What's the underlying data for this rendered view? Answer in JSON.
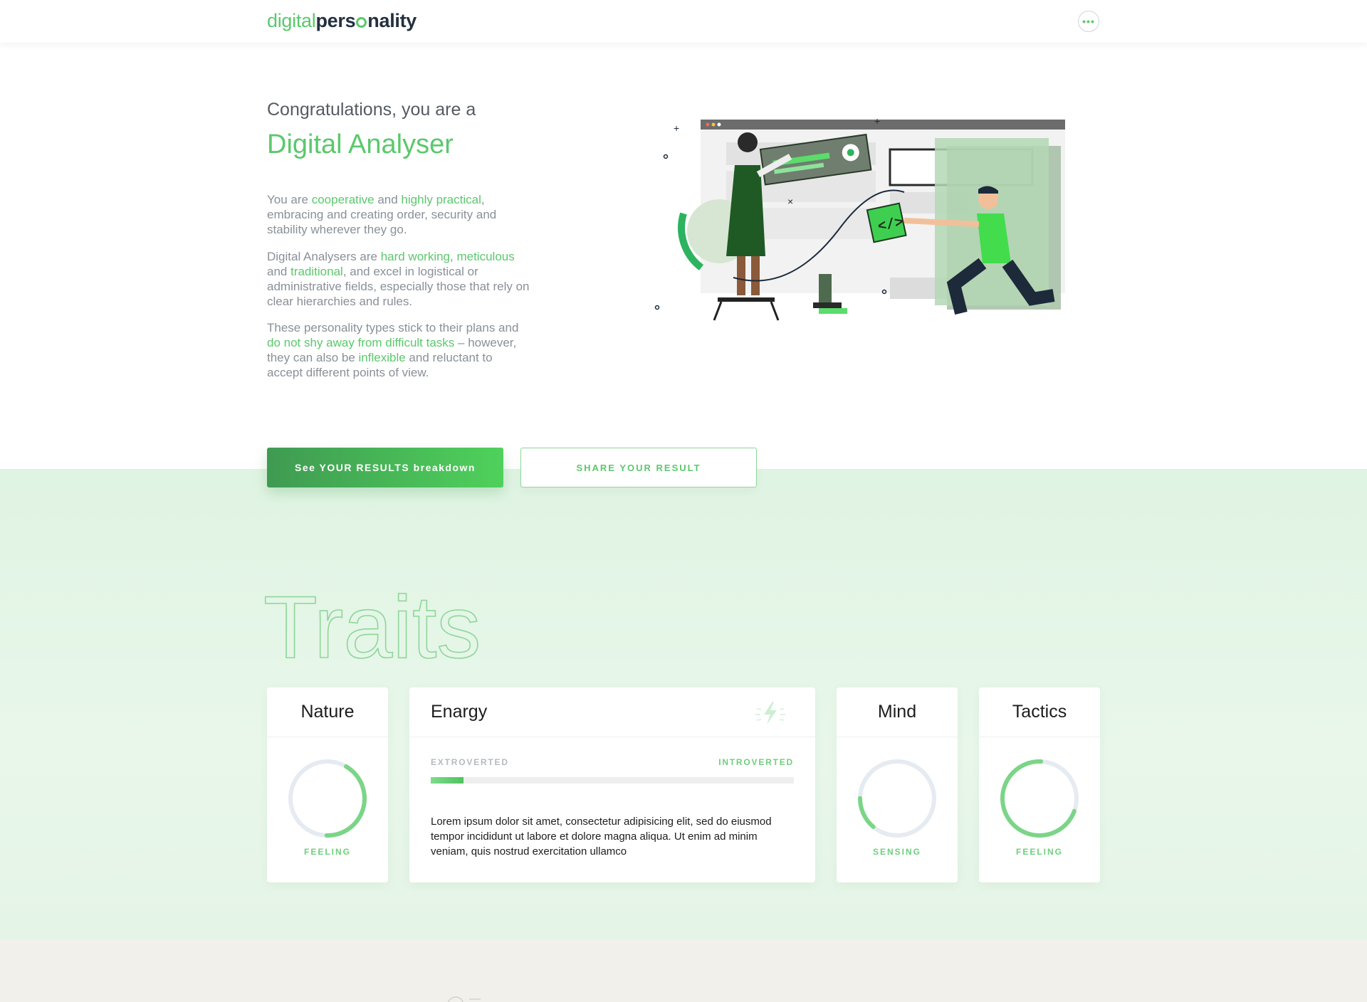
{
  "header": {
    "logo": {
      "part1": "digital",
      "part2": "pers",
      "part3": "nality"
    },
    "menu_icon": "more-dots-icon"
  },
  "hero": {
    "intro": "Congratulations, you are a",
    "title": "Digital Analyser",
    "p1": {
      "t1": "You are ",
      "h1": "cooperative",
      "t2": " and ",
      "h2": "highly practical",
      "t3": ", embracing and creating order, security and stability wherever they go."
    },
    "p2": {
      "t1": "Digital Analysers are ",
      "h1": "hard working",
      "t2": ", ",
      "h2": "meticulous",
      "t3": " and ",
      "h3": "traditional",
      "t4": ", and excel in logistical or administrative fields, especially those that rely on clear hierarchies and rules."
    },
    "p3": {
      "t1": "These personality types stick to their plans and ",
      "h1": "do not shy away from difficult tasks",
      "t2": " – however, they can also be ",
      "h2": "inflexible",
      "t3": " and reluctant to accept different points of view."
    }
  },
  "actions": {
    "primary": "See YOUR RESULTS breakdown",
    "secondary": "SHARE YOUR RESULT"
  },
  "traits": {
    "title": "Traits",
    "nature": {
      "title": "Nature",
      "label": "FEELING",
      "progress": 0.42
    },
    "energy": {
      "title": "Enargy",
      "icon": "lightning-icon",
      "left_label": "EXTROVERTED",
      "right_label": "INTROVERTED",
      "progress": 0.09,
      "text": "Lorem ipsum dolor sit amet, consectetur adipisicing elit, sed do eiusmod tempor incididunt ut labore et dolore magna aliqua. Ut enim ad minim veniam, quis nostrud exercitation ullamco"
    },
    "mind": {
      "title": "Mind",
      "label": "SENSING",
      "progress": 0.14
    },
    "tactics": {
      "title": "Tactics",
      "label": "FEELING",
      "progress": 0.7
    }
  },
  "colors": {
    "accent": "#5bc86c",
    "dark": "#233040",
    "band": "#e2f5e5",
    "ring_track": "#e5ebf0"
  }
}
